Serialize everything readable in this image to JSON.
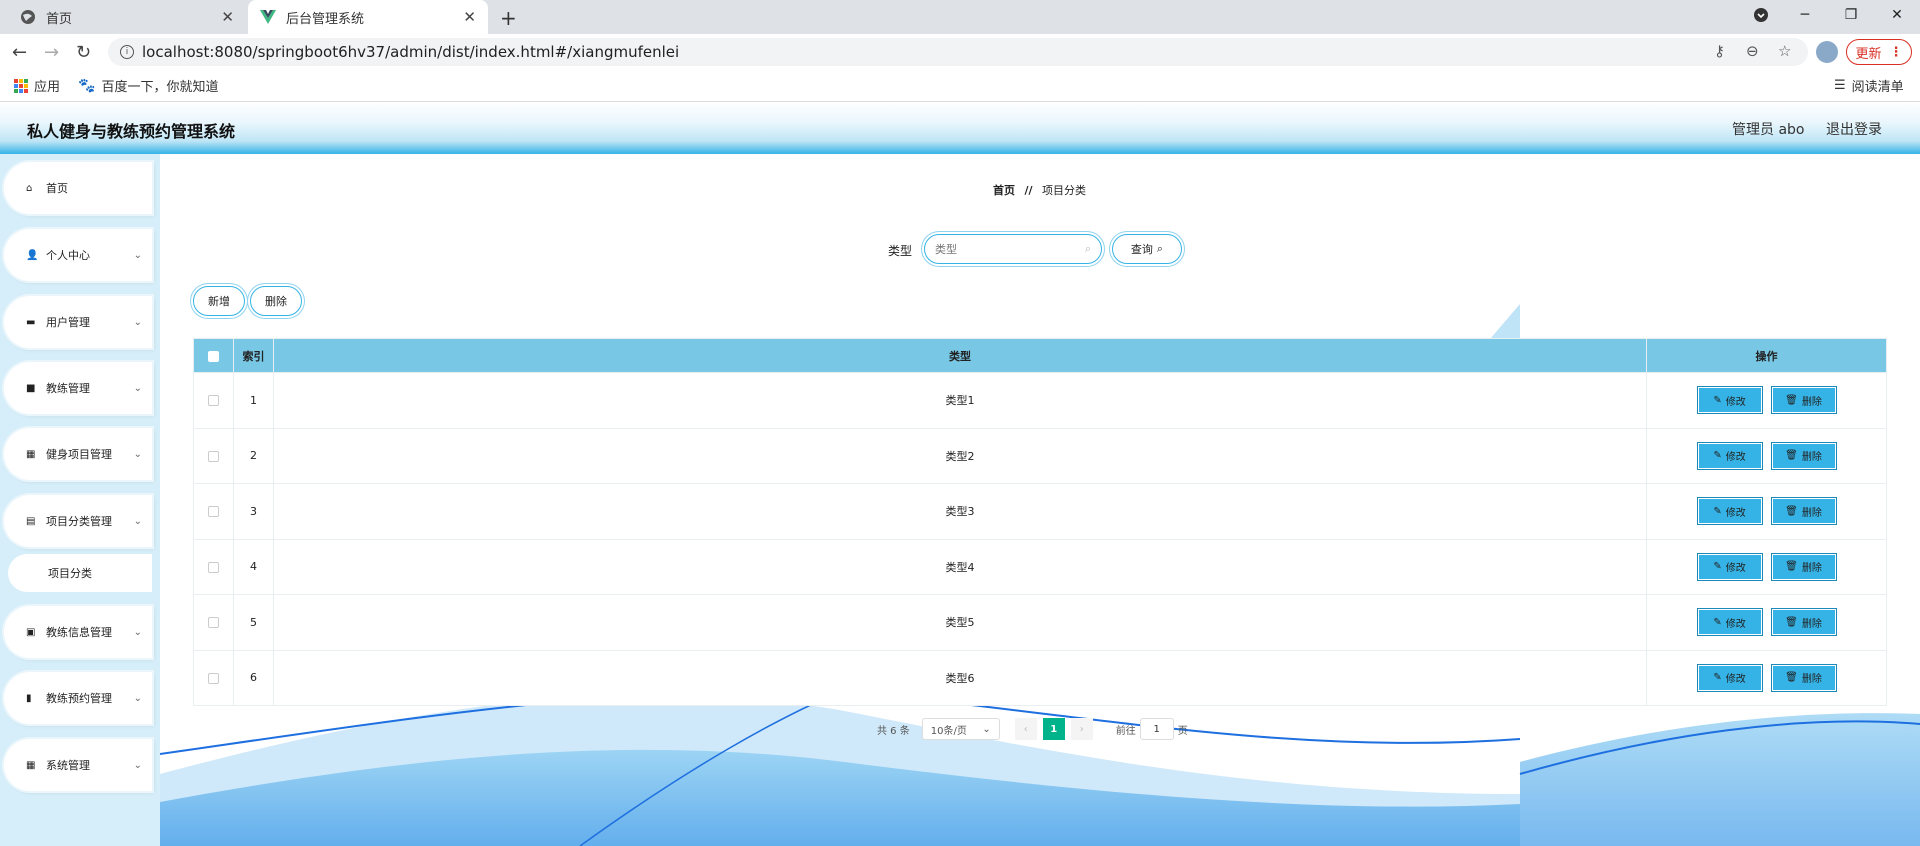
{
  "browser": {
    "tabs": [
      {
        "title": "首页",
        "icon": "globe-icon"
      },
      {
        "title": "后台管理系统",
        "icon": "vue-logo-icon"
      }
    ],
    "url": "localhost:8080/springboot6hv37/admin/dist/index.html#/xiangmufenlei",
    "update_label": "更新",
    "bookmarks": [
      {
        "label": "应用",
        "icon": "apps-grid-icon"
      },
      {
        "label": "百度一下，你就知道",
        "icon": "baidu-paw-icon"
      }
    ],
    "reading_list_label": "阅读清单"
  },
  "header": {
    "title": "私人健身与教练预约管理系统",
    "user_label": "管理员 abo",
    "logout_label": "退出登录"
  },
  "sidebar": {
    "items": [
      {
        "label": "首页",
        "icon": "home-icon",
        "expandable": false
      },
      {
        "label": "个人中心",
        "icon": "user-icon",
        "expandable": true
      },
      {
        "label": "用户管理",
        "icon": "monitor-icon",
        "expandable": true
      },
      {
        "label": "教练管理",
        "icon": "video-icon",
        "expandable": true
      },
      {
        "label": "健身项目管理",
        "icon": "grid-icon",
        "expandable": true
      },
      {
        "label": "项目分类管理",
        "icon": "clipboard-icon",
        "expandable": true
      },
      {
        "label": "教练信息管理",
        "icon": "briefcase-icon",
        "expandable": true
      },
      {
        "label": "教练预约管理",
        "icon": "bar-chart-icon",
        "expandable": true
      },
      {
        "label": "系统管理",
        "icon": "grid-icon",
        "expandable": true
      }
    ],
    "subitem": {
      "label": "项目分类"
    }
  },
  "main": {
    "breadcrumb": {
      "home": "首页",
      "separator": "//",
      "current": "项目分类"
    },
    "search": {
      "label": "类型",
      "placeholder": "类型",
      "query_label": "查询"
    },
    "actions": {
      "add_label": "新增",
      "delete_label": "删除"
    },
    "table": {
      "headers": {
        "index": "索引",
        "type": "类型",
        "ops": "操作"
      },
      "rows": [
        {
          "index": "1",
          "type": "类型1"
        },
        {
          "index": "2",
          "type": "类型2"
        },
        {
          "index": "3",
          "type": "类型3"
        },
        {
          "index": "4",
          "type": "类型4"
        },
        {
          "index": "5",
          "type": "类型5"
        },
        {
          "index": "6",
          "type": "类型6"
        }
      ],
      "edit_label": "修改",
      "delete_label": "删除"
    },
    "pagination": {
      "total_text": "共 6 条",
      "page_size": "10条/页",
      "current_page": "1",
      "goto_label": "前往",
      "goto_value": "1",
      "page_unit": "页"
    }
  },
  "colors": {
    "accent": "#35b3e6",
    "table_header": "#78c7e4",
    "sidebar_bg": "#d6eef9",
    "page_active": "#00b38a"
  }
}
